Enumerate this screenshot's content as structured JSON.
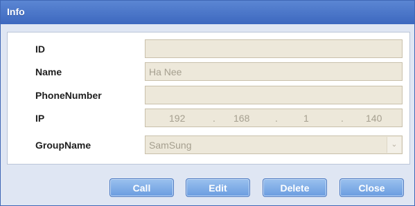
{
  "window": {
    "title": "Info"
  },
  "form": {
    "id": {
      "label": "ID",
      "value": ""
    },
    "name": {
      "label": "Name",
      "value": "Ha Nee"
    },
    "phone": {
      "label": "PhoneNumber",
      "value": ""
    },
    "ip": {
      "label": "IP",
      "octets": [
        "192",
        "168",
        "1",
        "140"
      ],
      "dot": "."
    },
    "group": {
      "label": "GroupName",
      "value": "SamSung",
      "arrow": "⌄"
    }
  },
  "buttons": {
    "call": "Call",
    "edit": "Edit",
    "delete": "Delete",
    "close": "Close"
  }
}
